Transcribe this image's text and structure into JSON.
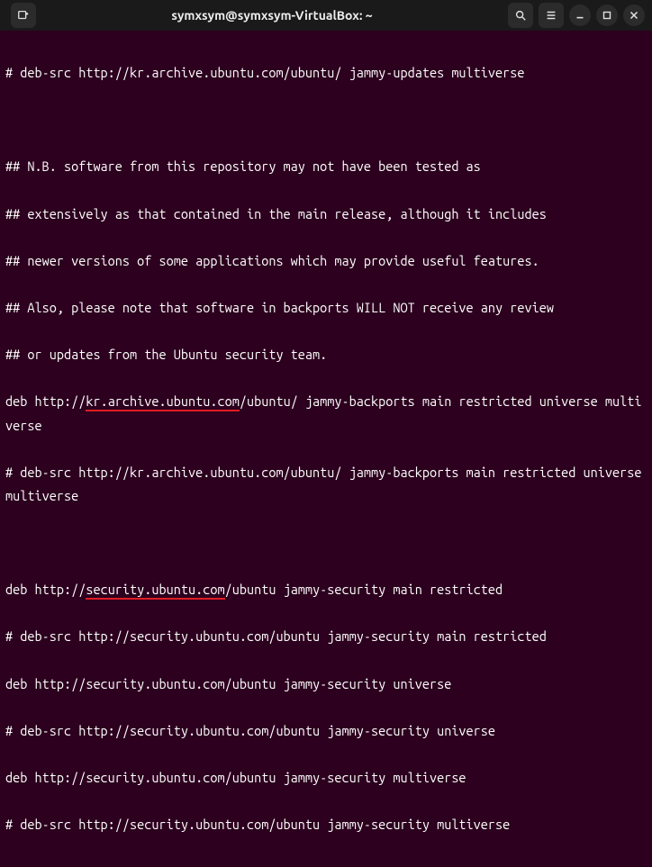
{
  "window": {
    "title": "symxsym@symxsym-VirtualBox: ~"
  },
  "lines": {
    "l1": "# deb-src http://kr.archive.ubuntu.com/ubuntu/ jammy-updates multiverse",
    "l2": "## N.B. software from this repository may not have been tested as",
    "l3": "## extensively as that contained in the main release, although it includes",
    "l4": "## newer versions of some applications which may provide useful features.",
    "l5": "## Also, please note that software in backports WILL NOT receive any review",
    "l6": "## or updates from the Ubuntu security team.",
    "l7a": "deb http://",
    "l7b": "kr.archive.ubuntu.com",
    "l7c": "/ubuntu/ jammy-backports main restricted universe multiverse",
    "l8": "# deb-src http://kr.archive.ubuntu.com/ubuntu/ jammy-backports main restricted universe multiverse",
    "l9a": "deb http://",
    "l9b": "security.ubuntu.com",
    "l9c": "/ubuntu jammy-security main restricted",
    "l10": "# deb-src http://security.ubuntu.com/ubuntu jammy-security main restricted",
    "l11": "deb http://security.ubuntu.com/ubuntu jammy-security universe",
    "l12": "# deb-src http://security.ubuntu.com/ubuntu jammy-security universe",
    "l13": "deb http://security.ubuntu.com/ubuntu jammy-security multiverse",
    "l14": "# deb-src http://security.ubuntu.com/ubuntu jammy-security multiverse"
  }
}
